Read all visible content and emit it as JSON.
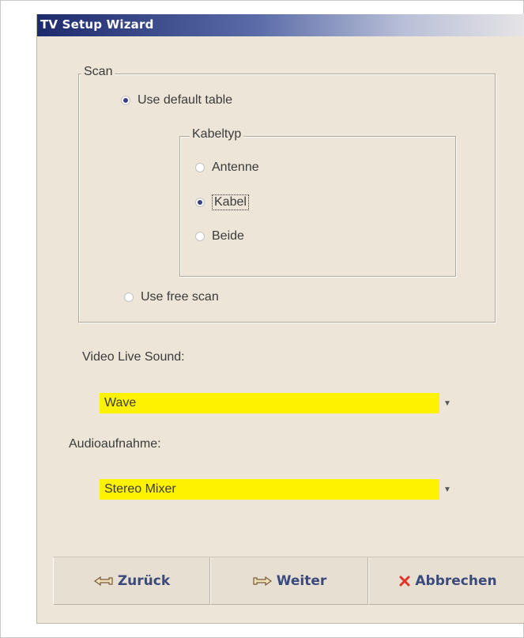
{
  "window": {
    "title": "TV Setup Wizard"
  },
  "scan_group": {
    "legend": "Scan",
    "use_default_table": {
      "label": "Use default table",
      "checked": true
    },
    "use_free_scan": {
      "label": "Use free scan",
      "checked": false
    }
  },
  "cable_group": {
    "legend": "Kabeltyp",
    "options": [
      {
        "label": "Antenne",
        "checked": false
      },
      {
        "label": "Kabel",
        "checked": true
      },
      {
        "label": "Beide",
        "checked": false
      }
    ]
  },
  "video_live_sound": {
    "label": "Video Live Sound:",
    "selected": "Wave"
  },
  "audio_recording": {
    "label": "Audioaufnahme:",
    "selected": "Stereo Mixer"
  },
  "buttons": {
    "back_label": "Zurück",
    "next_label": "Weiter",
    "cancel_label": "Abbrechen"
  },
  "colors": {
    "titlebar_start": "#1d2a6c",
    "dialog_bg": "#ede6d8",
    "select_bg": "#fff200",
    "cancel_icon": "#e0342a",
    "button_text": "#3b4a7a"
  },
  "icons": {
    "back": "hand-pointing-left-icon",
    "next": "hand-pointing-right-icon",
    "cancel": "x-icon",
    "dropdown": "chevron-down-icon"
  }
}
